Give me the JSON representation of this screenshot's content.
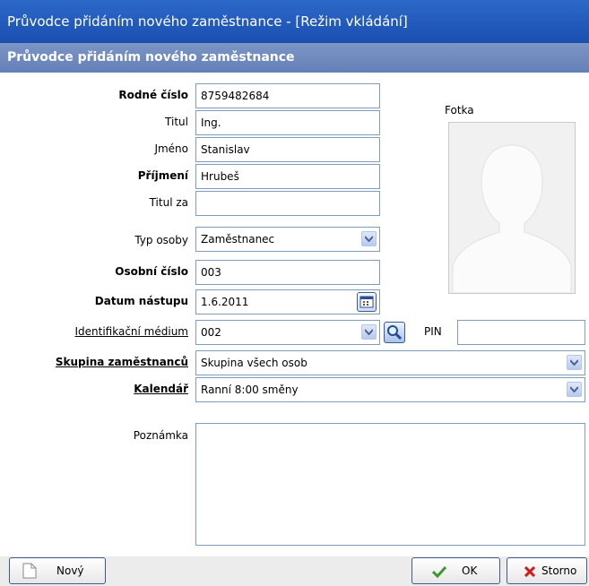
{
  "window": {
    "title": "Průvodce přidáním nového zaměstnance - [Režim vkládání]"
  },
  "header": {
    "title": "Průvodce přidáním nového zaměstnance"
  },
  "form": {
    "rodne_cislo": {
      "label": "Rodné číslo",
      "value": "8759482684"
    },
    "titul": {
      "label": "Titul",
      "value": "Ing."
    },
    "jmeno": {
      "label": "Jméno",
      "value": "Stanislav"
    },
    "prijmeni": {
      "label": "Příjmení",
      "value": "Hrubeš"
    },
    "titul_za": {
      "label": "Titul za",
      "value": ""
    },
    "typ_osoby": {
      "label": "Typ osoby",
      "value": "Zaměstnanec"
    },
    "osobni_cislo": {
      "label": "Osobní číslo",
      "value": "003"
    },
    "datum_nastupu": {
      "label": "Datum nástupu",
      "value": "1.6.2011"
    },
    "ident_medium": {
      "label": "Identifikační médium",
      "value": "002"
    },
    "pin": {
      "label": "PIN",
      "value": ""
    },
    "skupina": {
      "label": "Skupina zaměstnanců",
      "value": "Skupina všech osob"
    },
    "kalendar": {
      "label": "Kalendář",
      "value": "Ranní 8:00 směny"
    },
    "poznamka": {
      "label": "Poznámka",
      "value": ""
    }
  },
  "photo": {
    "label": "Fotka"
  },
  "buttons": {
    "new": "Nový",
    "ok": "OK",
    "cancel": "Storno"
  },
  "icons": {
    "calendar": "calendar-icon",
    "search": "search-icon",
    "new": "new-document-icon",
    "ok": "checkmark-icon",
    "cancel": "x-icon",
    "dropdown": "chevron-down-icon"
  },
  "colors": {
    "titlebar": "#1f58b9",
    "subheader": "#6f89bf",
    "ok_check": "#3a9a2f",
    "cancel_x": "#d11b1b"
  }
}
